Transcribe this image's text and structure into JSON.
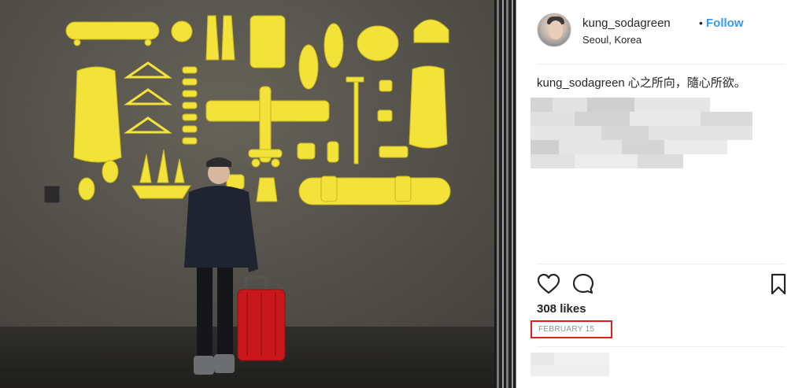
{
  "post": {
    "username": "kung_sodagreen",
    "follow_separator": "•",
    "follow_label": "Follow",
    "location": "Seoul, Korea",
    "caption_user": "kung_sodagreen",
    "caption_text": "心之所向，隨心所欲。",
    "likes": "308 likes",
    "date": "FEBRUARY 15"
  },
  "icons": {
    "like": "heart-icon",
    "comment": "comment-bubble-icon",
    "save": "bookmark-icon"
  },
  "colors": {
    "accent": "#3897f0",
    "highlight_box": "#e02020",
    "wall_objects": "#f2e23a",
    "suitcase": "#c8181c"
  }
}
